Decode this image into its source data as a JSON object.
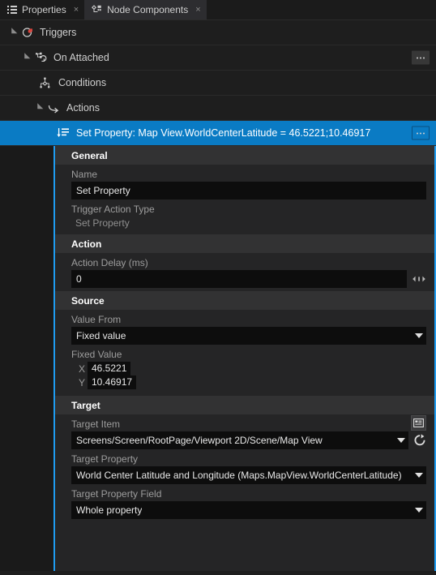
{
  "tabs": [
    {
      "label": "Properties",
      "icon": "list-icon",
      "active": false,
      "close": "×"
    },
    {
      "label": "Node Components",
      "icon": "components-icon",
      "active": true,
      "close": "×"
    }
  ],
  "tree": [
    {
      "label": "Triggers",
      "icon": "trigger-icon",
      "indent": 10,
      "expanded": true,
      "selected": false,
      "menu": false
    },
    {
      "label": "On Attached",
      "icon": "on-attached-icon",
      "indent": 26,
      "expanded": true,
      "selected": false,
      "menu": true
    },
    {
      "label": "Conditions",
      "icon": "conditions-icon",
      "indent": 48,
      "expanded": false,
      "selected": false,
      "menu": false
    },
    {
      "label": "Actions",
      "icon": "actions-arrow-icon",
      "indent": 42,
      "expanded": true,
      "selected": false,
      "menu": false
    },
    {
      "label": "Set Property: Map View.WorldCenterLatitude = 46.5221;10.46917",
      "icon": "set-property-icon",
      "indent": 70,
      "expanded": false,
      "selected": true,
      "menu": true
    }
  ],
  "sections": {
    "general": "General",
    "action": "Action",
    "source": "Source",
    "target": "Target"
  },
  "fields": {
    "name_label": "Name",
    "name_value": "Set Property",
    "trigger_action_type_label": "Trigger Action Type",
    "trigger_action_type_value": "Set Property",
    "action_delay_label": "Action Delay (ms)",
    "action_delay_value": "0",
    "value_from_label": "Value From",
    "value_from_value": "Fixed value",
    "fixed_value_label": "Fixed Value",
    "fixed_value_x_label": "X",
    "fixed_value_x": "46.5221",
    "fixed_value_y_label": "Y",
    "fixed_value_y": "10.46917",
    "target_item_label": "Target Item",
    "target_item_value": "Screens/Screen/RootPage/Viewport 2D/Scene/Map View",
    "target_property_label": "Target Property",
    "target_property_value": "World Center Latitude and Longitude (Maps.MapView.WorldCenterLatitude)",
    "target_property_field_label": "Target Property Field",
    "target_property_field_value": "Whole property"
  },
  "colors": {
    "selection_blue": "#0a7bc4",
    "rail_blue": "#1f9cf0",
    "panel_bg": "#252526",
    "tree_bg": "#1e1e1e",
    "section_header_bg": "#323233",
    "input_bg": "#0d0d0d",
    "trigger_red": "#d8433c"
  }
}
